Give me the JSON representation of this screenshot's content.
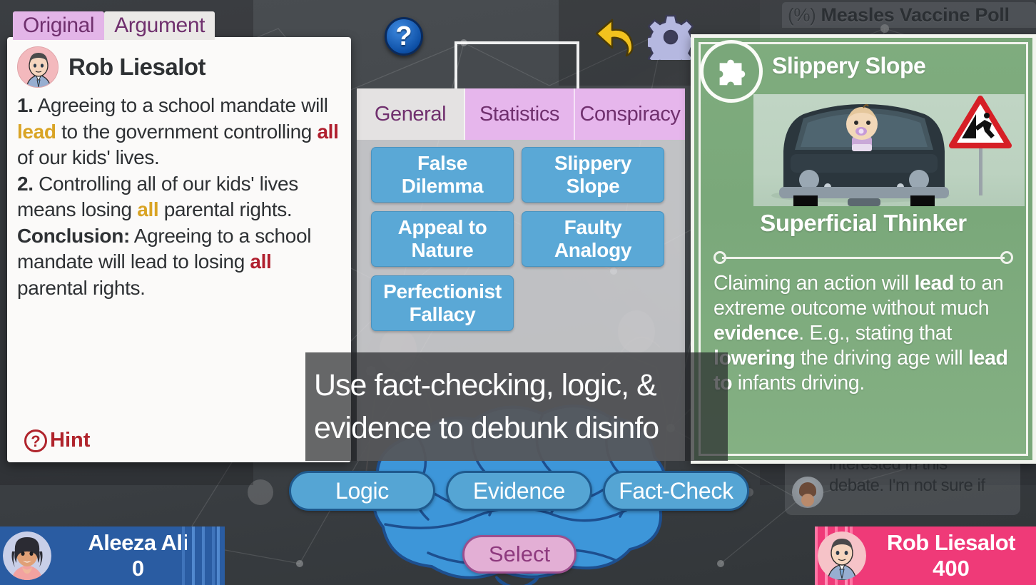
{
  "topbar": {
    "help_icon": "question-mark-icon",
    "undo_icon": "undo-arrow-icon",
    "gear_icon": "settings-gear-icon",
    "poll_prefix": "(%)",
    "poll_title": "Measles Vaccine Poll"
  },
  "argument_panel": {
    "tabs": [
      {
        "label": "Original",
        "active": false
      },
      {
        "label": "Argument",
        "active": true
      }
    ],
    "speaker": "Rob Liesalot",
    "avatar": "rob-avatar",
    "lines": [
      {
        "num": "1.",
        "parts": [
          {
            "t": " Agreeing to a school mandate will ",
            "style": "plain"
          },
          {
            "t": "lead",
            "style": "gold"
          },
          {
            "t": " to the government controlling ",
            "style": "plain"
          },
          {
            "t": "all",
            "style": "red"
          },
          {
            "t": " of our kids' lives.",
            "style": "plain"
          }
        ]
      },
      {
        "num": "2.",
        "parts": [
          {
            "t": " Controlling all of our kids' lives means losing ",
            "style": "plain"
          },
          {
            "t": "all",
            "style": "gold"
          },
          {
            "t": " parental rights.",
            "style": "plain"
          }
        ]
      },
      {
        "num": "Conclusion:",
        "parts": [
          {
            "t": " Agreeing to a school mandate will lead to losing ",
            "style": "plain"
          },
          {
            "t": "all",
            "style": "red"
          },
          {
            "t": " parental rights.",
            "style": "plain"
          }
        ]
      }
    ],
    "hint_label": "Hint",
    "hint_icon": "question-circle-icon"
  },
  "fallacy_panel": {
    "tabs": [
      {
        "label": "General",
        "active": true
      },
      {
        "label": "Statistics",
        "active": false
      },
      {
        "label": "Conspiracy",
        "active": false
      }
    ],
    "options": [
      "False Dilemma",
      "Slippery Slope",
      "Appeal to Nature",
      "Faulty Analogy",
      "Perfectionist Fallacy"
    ]
  },
  "fallacy_card": {
    "badge_icon": "puzzle-piece-icon",
    "title": "Slippery Slope",
    "subtitle": "Superficial Thinker",
    "image": "baby-driving-car-with-cliff-warning-sign",
    "description_parts": [
      {
        "t": "Claiming an action will ",
        "style": "plain"
      },
      {
        "t": "lead",
        "style": "bold"
      },
      {
        "t": " to an extreme outcome without much ",
        "style": "plain"
      },
      {
        "t": "evidence",
        "style": "bold"
      },
      {
        "t": ". E.g., stating that ",
        "style": "plain"
      },
      {
        "t": "lowering",
        "style": "bold"
      },
      {
        "t": " the driving age will ",
        "style": "plain"
      },
      {
        "t": "lead to",
        "style": "bold"
      },
      {
        "t": " infants driving.",
        "style": "plain"
      }
    ]
  },
  "toast": {
    "line1": "Use fact-checking, logic, &",
    "line2": "evidence to debunk disinfo"
  },
  "action_buttons": [
    {
      "label": "Logic",
      "id": "btn-logic"
    },
    {
      "label": "Evidence",
      "id": "btn-evidence"
    },
    {
      "label": "Fact-Check",
      "id": "btn-fact"
    }
  ],
  "select_button": {
    "label": "Select"
  },
  "background_comment": {
    "line1": "interested in this",
    "line2": "debate. I'm not sure if"
  },
  "players": {
    "left": {
      "name": "Aleeza Ali",
      "score": "0",
      "avatar": "aleeza-avatar"
    },
    "right": {
      "name": "Rob Liesalot",
      "score": "400",
      "avatar": "rob-avatar"
    }
  },
  "colors": {
    "tab_inactive": "#e3b5e8",
    "tab_active": "#ebe9e7",
    "fallacy_button": "#5aa8d6",
    "card_green": "#7aa77a",
    "player_left": "#2a5ca2",
    "player_right": "#ef3a78",
    "highlight_gold": "#d9a425",
    "highlight_red": "#b01f2e",
    "hint_red": "#b0242c",
    "tab_text_purple": "#70306e"
  }
}
